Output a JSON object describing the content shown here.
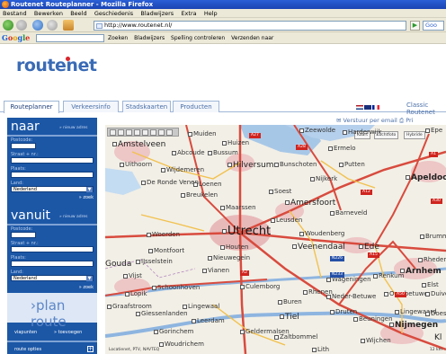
{
  "window": {
    "title": "Routenet Routeplanner - Mozilla Firefox"
  },
  "menubar": [
    "Bestand",
    "Bewerken",
    "Beeld",
    "Geschiedenis",
    "Bladwijzers",
    "Extra",
    "Help"
  ],
  "navbar": {
    "url": "http://www.routenet.nl/",
    "search_placeholder": "Goo"
  },
  "google_toolbar": {
    "logo": [
      "G",
      "o",
      "o",
      "g",
      "l",
      "e"
    ],
    "items": [
      "Zoeken",
      "Bladwijzers",
      "Spelling controleren",
      "Verzenden naar"
    ]
  },
  "site": {
    "logo": "routenet"
  },
  "tabs": [
    "Routeplanner",
    "Verkeersinfo",
    "Stadskaarten",
    "Producten"
  ],
  "header_right": {
    "classic": "Classic Routenet"
  },
  "sidebar": {
    "naar": {
      "title": "naar",
      "nieuw": "» nieuw adres",
      "postcode": "Postcode:",
      "straat": "Straat + nr.:",
      "plaats": "Plaats:",
      "land": "Land:",
      "land_value": "Nederland",
      "zoek": "» zoek"
    },
    "vanuit": {
      "title": "vanuit",
      "nieuw": "» nieuw adres",
      "postcode": "Postcode:",
      "straat": "Straat + nr.:",
      "plaats": "Plaats:",
      "land": "Land:",
      "land_value": "Nederland",
      "zoek": "» zoek"
    },
    "plan_route": "›plan route",
    "viapunten": "viapunten",
    "toevoegen": "» toevoegen",
    "route_opties": "route opties",
    "route_opties_toggle": "+"
  },
  "map_actions": {
    "email": "Verstuur per email",
    "print": "Pri"
  },
  "map": {
    "buttons": [
      "Kaart",
      "Luchtfoto",
      "Hybride"
    ],
    "cities": [
      "Amstelveen",
      "Muiden",
      "Huizen",
      "Zeewolde",
      "Harderwijk",
      "Ermelo",
      "Epe",
      "Abcoude",
      "Bussum",
      "Uithoorn",
      "Wijdemeren",
      "Hilversum",
      "Bunschoten",
      "Putten",
      "Nijkerk",
      "Apeldoorn",
      "De Ronde Venen",
      "Loenen",
      "Breukelen",
      "Soest",
      "Amersfoort",
      "Barneveld",
      "Maarssen",
      "Leusden",
      "Woerden",
      "Utrecht",
      "Woudenberg",
      "Veenendaal",
      "Ede",
      "Montfoort",
      "Houten",
      "IJsselstein",
      "Nieuwegein",
      "Gouda",
      "Vianen",
      "Vijst",
      "Schoonhoven",
      "Culemborg",
      "Wageningen",
      "Renkum",
      "Arnhem",
      "Rheden",
      "Lopik",
      "Lingewaal",
      "Leerdam",
      "Buren",
      "Tiel",
      "Neder-Betuwe",
      "Overbetuwe",
      "Duiven",
      "Geldermalsen",
      "Druten",
      "Beuningen",
      "Lingewaard",
      "Nijmegen",
      "Gorinchem",
      "Zaltbommel",
      "Wijchen",
      "Woudrichem",
      "Lith",
      "Graafstroom",
      "Giessenlanden",
      "Brummen",
      "Doesburg",
      "Rhenen",
      "Elst",
      "Kl"
    ],
    "roads": [
      "A27",
      "A28",
      "A12",
      "A2",
      "A15",
      "A1",
      "A30",
      "N226",
      "N233",
      "A50"
    ],
    "copyright": "Locatienet, PTV, NAVTEQ",
    "scale": "12 km"
  },
  "colors": {
    "brand_blue": "#1c57a6",
    "map_land": "#f2efe6",
    "map_water": "#a7c7e7",
    "map_city": "#e8b9b9",
    "motorway": "#d84b3e",
    "secondary_road": "#f2c14e"
  }
}
